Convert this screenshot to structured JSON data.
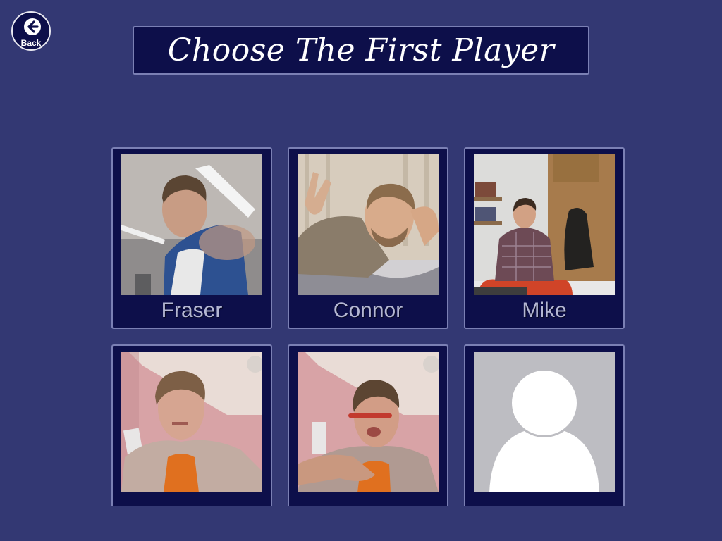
{
  "back_button": {
    "label": "Back",
    "icon": "arrow-left-icon"
  },
  "title": "Choose The First Player",
  "players": [
    {
      "name": "Fraser",
      "photo": "selfie-photo"
    },
    {
      "name": "Connor",
      "photo": "selfie-photo"
    },
    {
      "name": "Mike",
      "photo": "office-photo"
    },
    {
      "name": "",
      "photo": "selfie-photo"
    },
    {
      "name": "",
      "photo": "selfie-photo"
    },
    {
      "name": "",
      "photo": "default-avatar-icon"
    }
  ],
  "colors": {
    "background": "#333873",
    "panel": "#0d0f4a",
    "panel_border": "#7b80b4",
    "name_text": "#b4b7d3",
    "avatar_bg": "#bdbdc2"
  }
}
